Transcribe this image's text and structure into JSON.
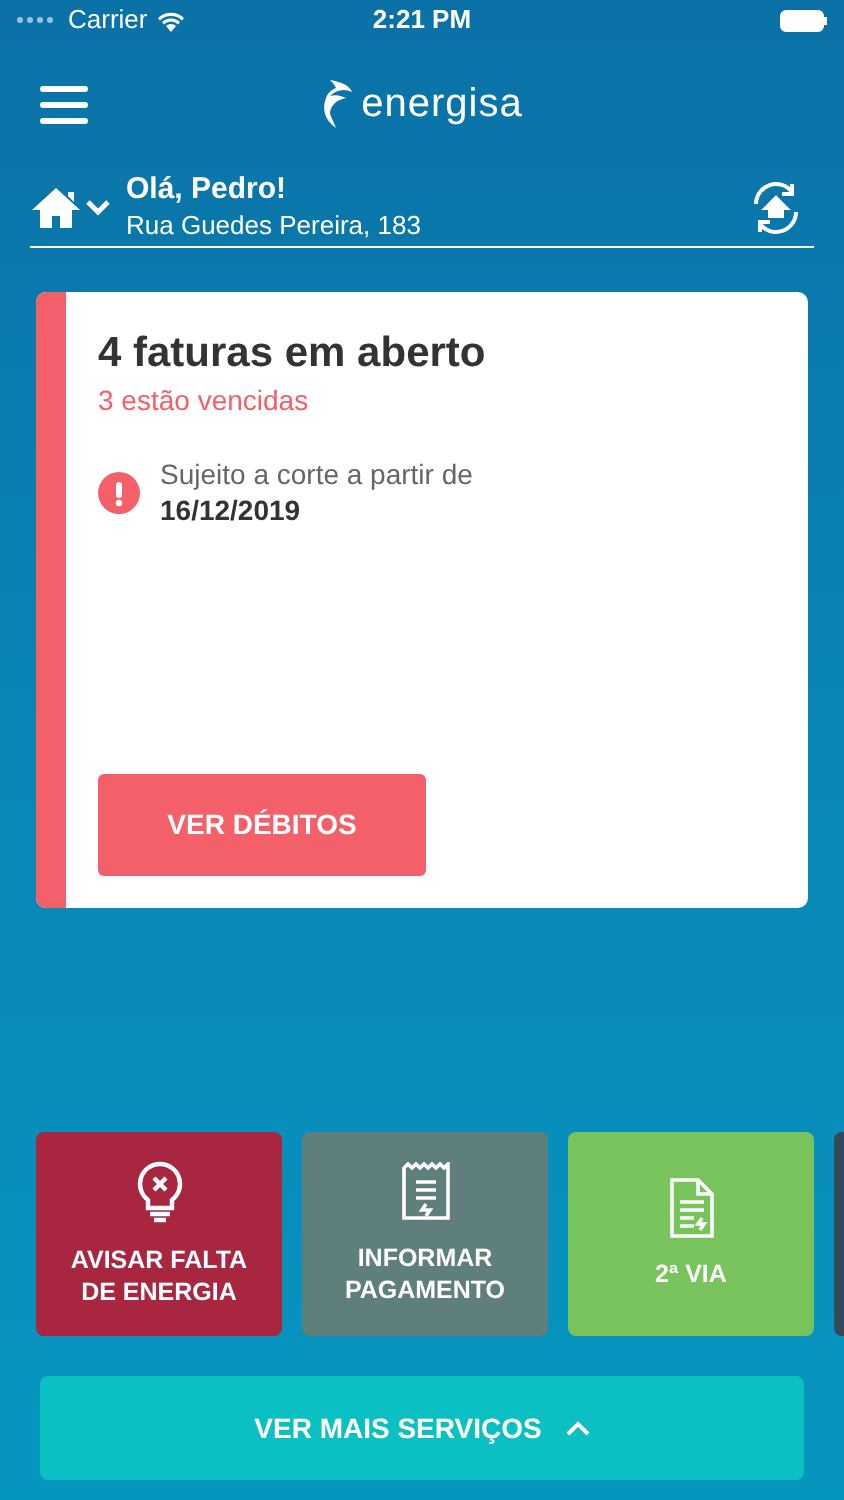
{
  "status_bar": {
    "carrier": "Carrier",
    "time": "2:21 PM"
  },
  "header": {
    "logo_text": "energisa"
  },
  "account": {
    "greeting": "Olá, Pedro!",
    "address": "Rua Guedes Pereira, 183"
  },
  "invoice_card": {
    "title": "4 faturas em aberto",
    "subtitle": "3 estão vencidas",
    "warning": "Sujeito a corte a partir de",
    "date": "16/12/2019",
    "button": "VER DÉBITOS"
  },
  "services": [
    {
      "kind": "outage",
      "label": "AVISAR FALTA DE ENERGIA",
      "color": "#a8263f"
    },
    {
      "kind": "payment",
      "label": "INFORMAR PAGAMENTO",
      "color": "#5e7f7b"
    },
    {
      "kind": "copy",
      "label": "2ª VIA",
      "color": "#78c35c"
    },
    {
      "kind": "partial",
      "color": "#34495a"
    }
  ],
  "more_button": "VER MAIS SERVIÇOS"
}
